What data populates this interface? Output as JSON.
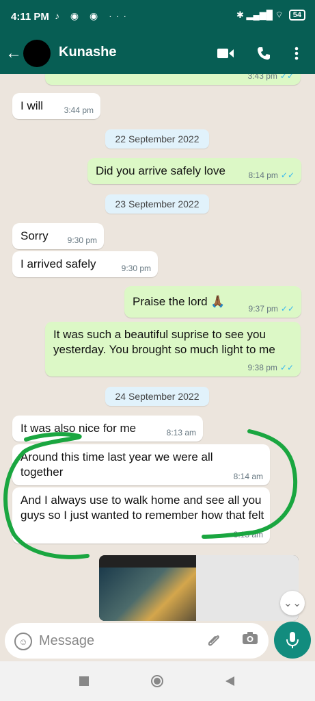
{
  "status_bar": {
    "time": "4:11 PM",
    "icons": "♪ ◉ ◉ ···",
    "signal": "✱ ▂▄▆█ ⌔",
    "battery": "54"
  },
  "header": {
    "contact_name": "Kunashe"
  },
  "messages": [
    {
      "text": "",
      "time": "3:43 pm"
    },
    {
      "text": "I will",
      "time": "3:44 pm"
    },
    {
      "text": "Did you arrive safely love",
      "time": "8:14 pm"
    },
    {
      "text": "Sorry",
      "time": "9:30 pm"
    },
    {
      "text": "I arrived safely",
      "time": "9:30 pm"
    },
    {
      "text": "Praise the lord 🙏🏾",
      "time": "9:37 pm"
    },
    {
      "text": "It was such a beautiful suprise to see you yesterday. You brought so much light to me",
      "time": "9:38 pm"
    },
    {
      "text": "It was also nice for me",
      "time": "8:13 am"
    },
    {
      "text": "Around this time last year we were all together",
      "time": "8:14 am"
    },
    {
      "text": "And I always use to walk home and see all you guys  so I just wanted to remember how that felt",
      "time": "8:15 am"
    }
  ],
  "date_separators": [
    "22 September 2022",
    "23 September 2022",
    "24 September 2022"
  ],
  "input": {
    "placeholder": "Message"
  },
  "colors": {
    "header": "#075e54",
    "outgoing": "#dcf8c6",
    "incoming": "#ffffff",
    "accent": "#128c7e",
    "annotation": "#1aa640"
  }
}
